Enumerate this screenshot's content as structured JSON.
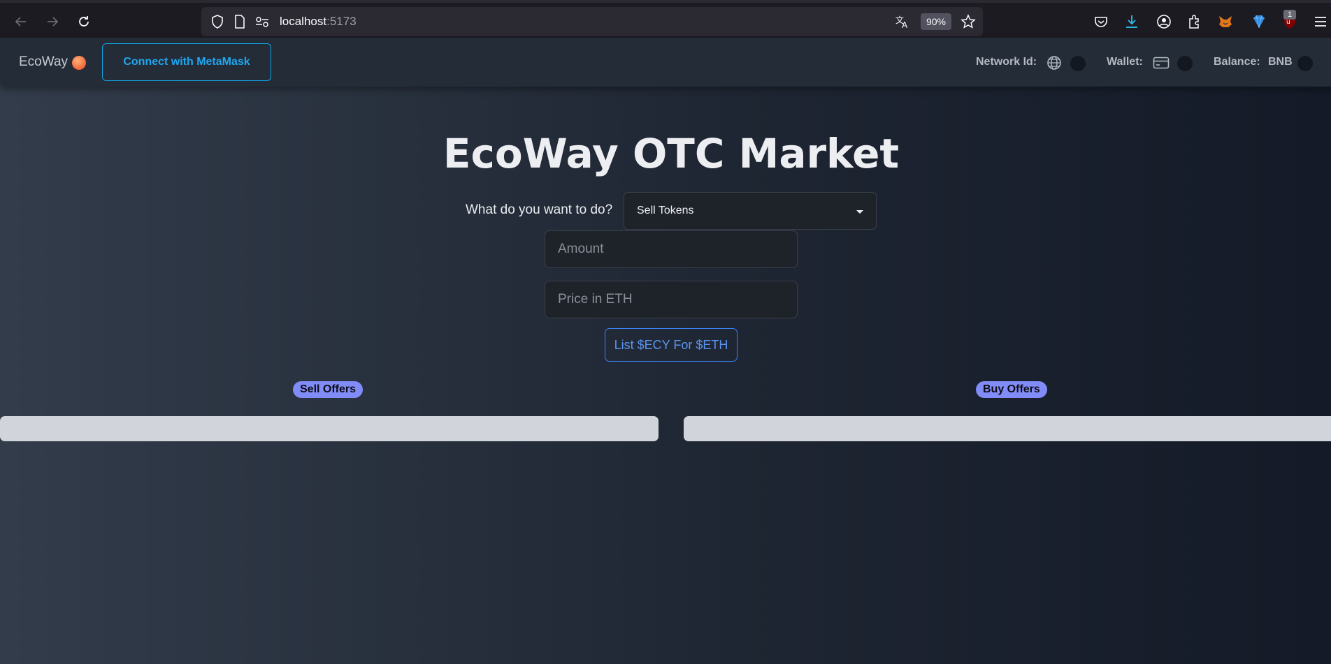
{
  "browser": {
    "url_host": "localhost",
    "url_port": ":5173",
    "zoom": "90%",
    "extension_badge_count": "1",
    "icons": [
      "back-icon",
      "forward-icon",
      "reload-icon",
      "shield-icon",
      "page-icon",
      "permissions-icon",
      "translate-icon",
      "bookmark-star-icon",
      "pocket-icon",
      "download-icon",
      "account-icon",
      "extensions-icon",
      "metamask-fox-icon",
      "diamond-extension-icon",
      "ublock-icon",
      "menu-icon"
    ]
  },
  "nav": {
    "brand": "EcoWay",
    "connect_label": "Connect with MetaMask",
    "network_label": "Network Id:",
    "wallet_label": "Wallet:",
    "balance_label": "Balance:",
    "balance_unit": "BNB"
  },
  "main": {
    "title": "EcoWay OTC Market",
    "question": "What do you want to do?",
    "action_select_value": "Sell Tokens",
    "amount_placeholder": "Amount",
    "price_placeholder": "Price in ETH",
    "list_button": "List $ECY For $ETH",
    "sell_offers_label": "Sell Offers",
    "buy_offers_label": "Buy Offers"
  },
  "colors": {
    "accent_cyan": "#0ea5e9",
    "accent_blue": "#3b82f6",
    "pill_indigo": "#818cf8",
    "brand_orange": "#f2653a"
  }
}
